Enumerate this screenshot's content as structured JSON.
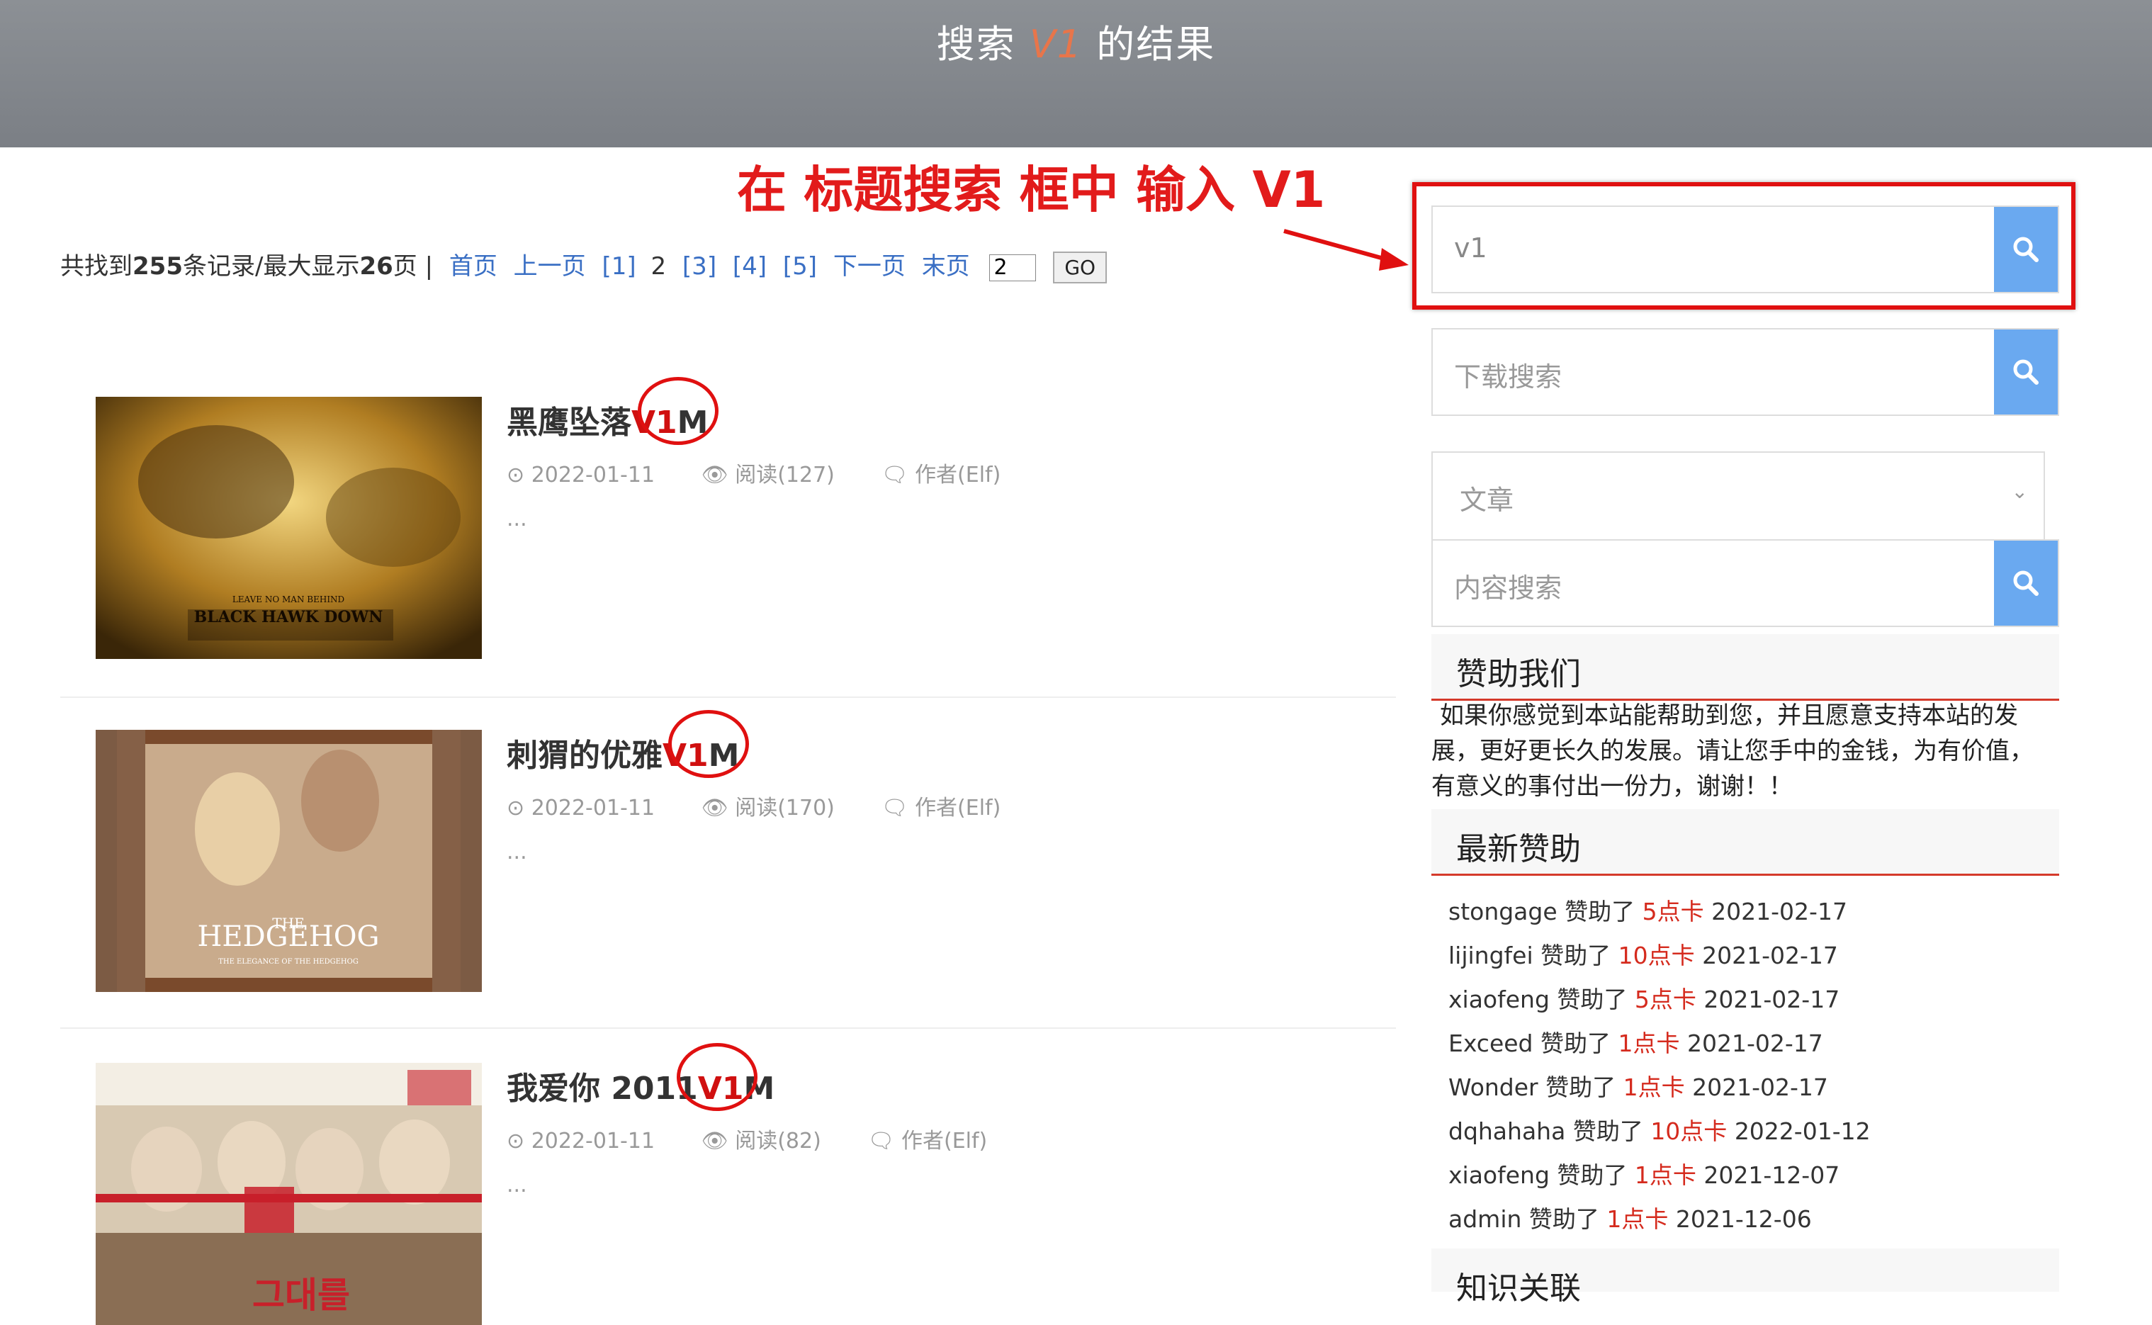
{
  "header": {
    "title_prefix": "搜索 ",
    "title_keyword": "V1",
    "title_suffix": " 的结果"
  },
  "annotation": {
    "text": "在 标题搜索 框中 输入 V1"
  },
  "pager": {
    "found_prefix": "共找到",
    "total_records": "255",
    "found_mid": "条记录/最大显示",
    "total_pages": "26",
    "found_suffix": "页 |",
    "first": "首页",
    "prev": "上一页",
    "pages": [
      "[1]",
      "2",
      "[3]",
      "[4]",
      "[5]"
    ],
    "next": "下一页",
    "last": "末页",
    "input_value": "2",
    "go": "GO"
  },
  "articles": [
    {
      "title": "黑鹰坠落",
      "kw": "V1",
      "suffix": "M",
      "date": "2022-01-11",
      "views": "阅读(127)",
      "author": "作者(Elf)",
      "excerpt": "...",
      "poster_lines": [
        "LEAVE NO MAN BEHIND",
        "BLACK HAWK DOWN"
      ]
    },
    {
      "title": "刺猬的优雅",
      "kw": "V1",
      "suffix": "M",
      "date": "2022-01-11",
      "views": "阅读(170)",
      "author": "作者(Elf)",
      "excerpt": "...",
      "poster_lines": [
        "THE",
        "HEDGEHOG",
        "THE ELEGANCE OF THE HEDGEHOG"
      ]
    },
    {
      "title": "我爱你 2011",
      "kw": "V1",
      "suffix": "M",
      "date": "2022-01-11",
      "views": "阅读(82)",
      "author": "作者(Elf)",
      "excerpt": "...",
      "poster_lines": [
        "그대를"
      ]
    }
  ],
  "sidebar": {
    "title_search_value": "v1",
    "download_search_placeholder": "下载搜索",
    "content_select": "文章",
    "content_search_placeholder": "内容搜索",
    "sponsor_title": "赞助我们",
    "sponsor_text": "如果你感觉到本站能帮助到您，并且愿意支持本站的发展，更好更长久的发展。请让您手中的金钱，为有价值，有意义的事付出一份力，谢谢！！",
    "latest_title": "最新赞助",
    "donations": [
      {
        "user": "stongage",
        "verb": "赞助了",
        "amount": "5点卡",
        "date": "2021-02-17"
      },
      {
        "user": "lijingfei",
        "verb": "赞助了",
        "amount": "10点卡",
        "date": "2021-02-17"
      },
      {
        "user": "xiaofeng",
        "verb": "赞助了",
        "amount": "5点卡",
        "date": "2021-02-17"
      },
      {
        "user": "Exceed",
        "verb": "赞助了",
        "amount": "1点卡",
        "date": "2021-02-17"
      },
      {
        "user": "Wonder",
        "verb": "赞助了",
        "amount": "1点卡",
        "date": "2021-02-17"
      },
      {
        "user": "dqhahaha",
        "verb": "赞助了",
        "amount": "10点卡",
        "date": "2022-01-12"
      },
      {
        "user": "xiaofeng",
        "verb": "赞助了",
        "amount": "1点卡",
        "date": "2021-12-07"
      },
      {
        "user": "admin",
        "verb": "赞助了",
        "amount": "1点卡",
        "date": "2021-12-06"
      }
    ],
    "knowledge_title": "知识关联"
  },
  "colors": {
    "accent_red": "#d52b1e",
    "link_blue": "#3a6fc4",
    "search_button": "#6aa9f0",
    "header_gray": "#85898e"
  }
}
